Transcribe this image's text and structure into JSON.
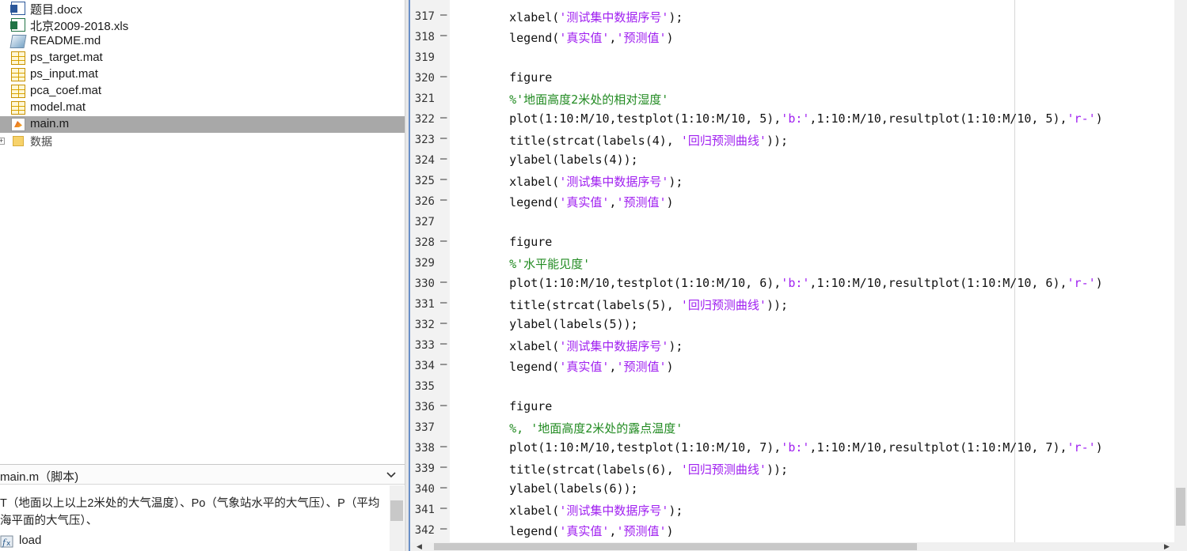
{
  "files": [
    {
      "name": "题目.docx",
      "icon": "word-doc-icon",
      "type": "word"
    },
    {
      "name": "北京2009-2018.xls",
      "icon": "excel-file-icon",
      "type": "excel"
    },
    {
      "name": "README.md",
      "icon": "markdown-file-icon",
      "type": "md"
    },
    {
      "name": "ps_target.mat",
      "icon": "mat-file-icon",
      "type": "mat"
    },
    {
      "name": "ps_input.mat",
      "icon": "mat-file-icon",
      "type": "mat"
    },
    {
      "name": "pca_coef.mat",
      "icon": "mat-file-icon",
      "type": "mat"
    },
    {
      "name": "model.mat",
      "icon": "mat-file-icon",
      "type": "mat"
    },
    {
      "name": "main.m",
      "icon": "matlab-script-icon",
      "type": "m",
      "selected": true
    }
  ],
  "folder": {
    "name": "数据",
    "icon": "folder-icon",
    "expander": "+"
  },
  "details": {
    "title": "main.m（脚本)",
    "description": "T（地面以上以上2米处的大气温度）、Po（气象站水平的大气压）、P（平均海平面的大气压）、",
    "load_label": "load"
  },
  "code_lines": [
    {
      "num": "317",
      "dash": "—",
      "html": "    xlabel(<span class=\"s\">'测试集中数据序号'</span>);"
    },
    {
      "num": "318",
      "dash": "—",
      "html": "    legend(<span class=\"s\">'真实值'</span>,<span class=\"s\">'预测值'</span>)"
    },
    {
      "num": "319",
      "dash": "",
      "html": ""
    },
    {
      "num": "320",
      "dash": "—",
      "html": "    figure"
    },
    {
      "num": "321",
      "dash": "",
      "html": "    <span class=\"c\">%'地面高度2米处的相对湿度'</span>"
    },
    {
      "num": "322",
      "dash": "—",
      "html": "    plot(1:10:M/10,testplot(1:10:M/10, 5),<span class=\"s\">'b:'</span>,1:10:M/10,resultplot(1:10:M/10, 5),<span class=\"s\">'r-'</span>)"
    },
    {
      "num": "323",
      "dash": "—",
      "html": "    title(strcat(labels(4), <span class=\"s\">'回归预测曲线'</span>));"
    },
    {
      "num": "324",
      "dash": "—",
      "html": "    ylabel(labels(4));"
    },
    {
      "num": "325",
      "dash": "—",
      "html": "    xlabel(<span class=\"s\">'测试集中数据序号'</span>);"
    },
    {
      "num": "326",
      "dash": "—",
      "html": "    legend(<span class=\"s\">'真实值'</span>,<span class=\"s\">'预测值'</span>)"
    },
    {
      "num": "327",
      "dash": "",
      "html": ""
    },
    {
      "num": "328",
      "dash": "—",
      "html": "    figure"
    },
    {
      "num": "329",
      "dash": "",
      "html": "    <span class=\"c\">%'水平能见度'</span>"
    },
    {
      "num": "330",
      "dash": "—",
      "html": "    plot(1:10:M/10,testplot(1:10:M/10, 6),<span class=\"s\">'b:'</span>,1:10:M/10,resultplot(1:10:M/10, 6),<span class=\"s\">'r-'</span>)"
    },
    {
      "num": "331",
      "dash": "—",
      "html": "    title(strcat(labels(5), <span class=\"s\">'回归预测曲线'</span>));"
    },
    {
      "num": "332",
      "dash": "—",
      "html": "    ylabel(labels(5));"
    },
    {
      "num": "333",
      "dash": "—",
      "html": "    xlabel(<span class=\"s\">'测试集中数据序号'</span>);"
    },
    {
      "num": "334",
      "dash": "—",
      "html": "    legend(<span class=\"s\">'真实值'</span>,<span class=\"s\">'预测值'</span>)"
    },
    {
      "num": "335",
      "dash": "",
      "html": ""
    },
    {
      "num": "336",
      "dash": "—",
      "html": "    figure"
    },
    {
      "num": "337",
      "dash": "",
      "html": "    <span class=\"c\">%, '地面高度2米处的露点温度'</span>"
    },
    {
      "num": "338",
      "dash": "—",
      "html": "    plot(1:10:M/10,testplot(1:10:M/10, 7),<span class=\"s\">'b:'</span>,1:10:M/10,resultplot(1:10:M/10, 7),<span class=\"s\">'r-'</span>)"
    },
    {
      "num": "339",
      "dash": "—",
      "html": "    title(strcat(labels(6), <span class=\"s\">'回归预测曲线'</span>));"
    },
    {
      "num": "340",
      "dash": "—",
      "html": "    ylabel(labels(6));"
    },
    {
      "num": "341",
      "dash": "—",
      "html": "    xlabel(<span class=\"s\">'测试集中数据序号'</span>);"
    },
    {
      "num": "342",
      "dash": "—",
      "html": "    legend(<span class=\"s\">'真实值'</span>,<span class=\"s\">'预测值'</span>)"
    }
  ],
  "colors": {
    "string": "#a020f0",
    "comment": "#228b22",
    "selection": "#a8a8a8",
    "divider": "#6a8fc7"
  }
}
